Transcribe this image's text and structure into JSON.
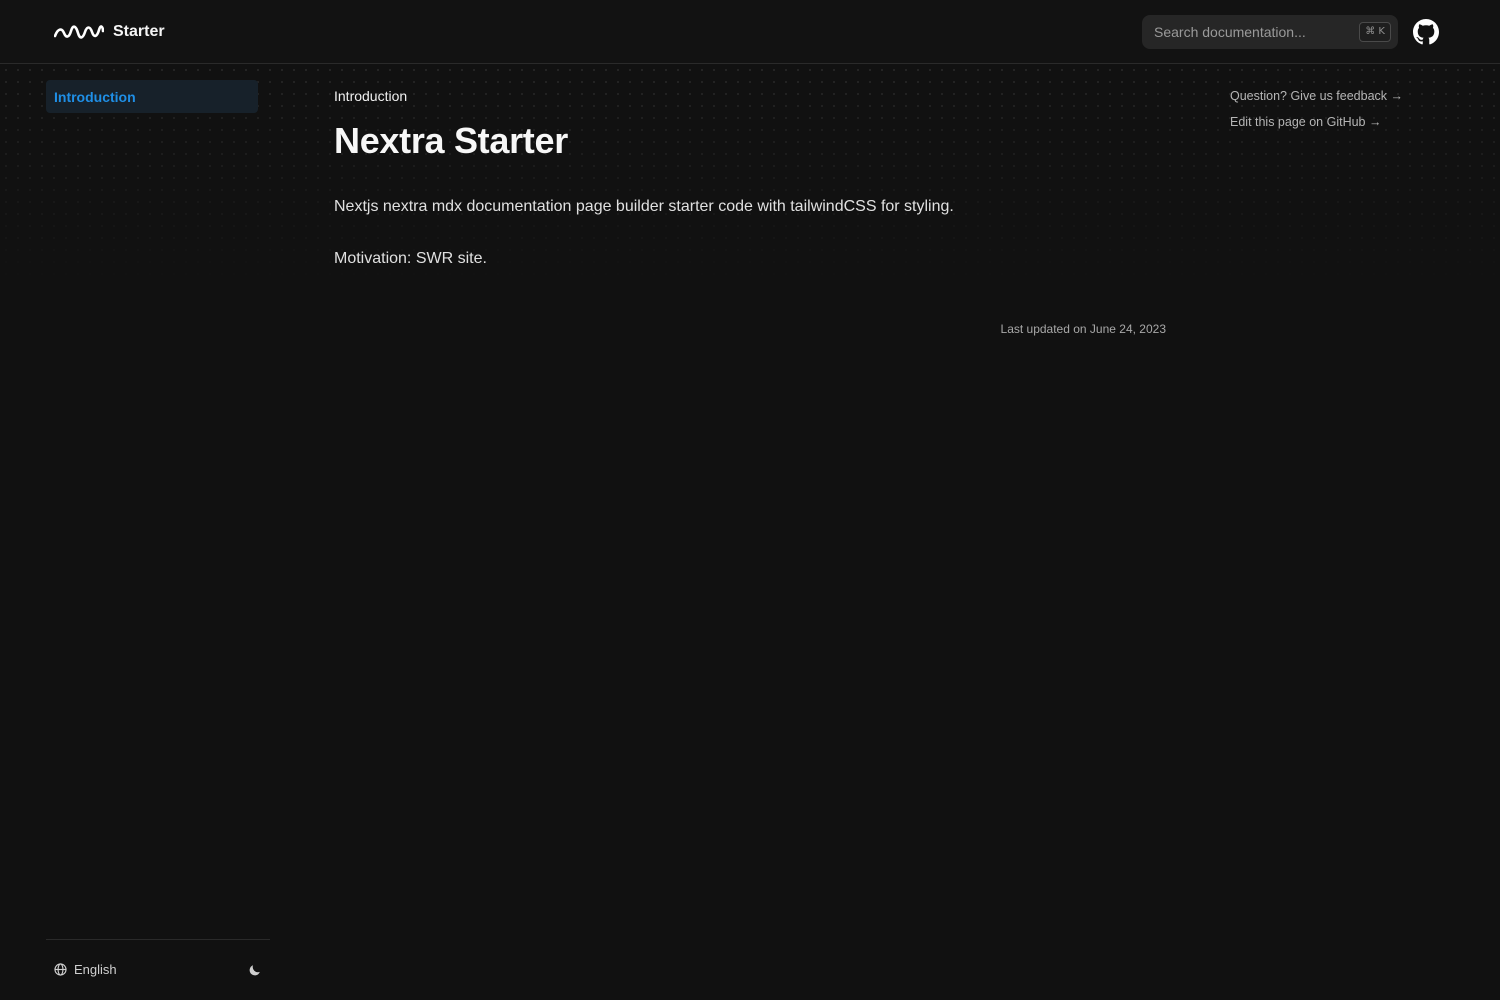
{
  "navbar": {
    "brand": "Starter",
    "search_placeholder": "Search documentation...",
    "search_shortcut": "⌘ K",
    "logo_icon": "swr-wave-logo-icon",
    "github_icon": "github-icon"
  },
  "sidebar": {
    "items": [
      {
        "label": "Introduction",
        "active": true
      }
    ],
    "footer": {
      "language": "English",
      "language_icon": "globe-icon",
      "theme_icon": "moon-icon"
    }
  },
  "main": {
    "breadcrumb": "Introduction",
    "title": "Nextra Starter",
    "paragraphs": [
      "Nextjs nextra mdx documentation page builder starter code with tailwindCSS for styling.",
      "Motivation: SWR site."
    ],
    "last_updated": "Last updated on June 24, 2023"
  },
  "toc": {
    "feedback_link": "Question? Give us feedback →",
    "edit_link": "Edit this page on GitHub →"
  },
  "colors": {
    "background": "#111111",
    "accent": "#1f8fe6",
    "active_bg": "#17212a"
  }
}
